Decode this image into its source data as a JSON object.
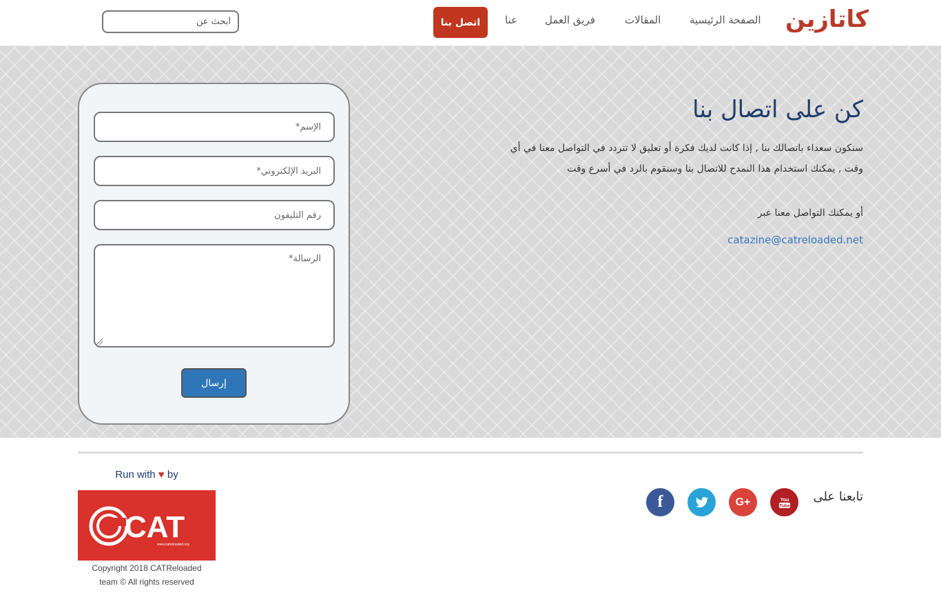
{
  "nav": {
    "brand": "كاتازين",
    "home": "الصفحة الرئيسية",
    "articles": "المقالات",
    "team": "فريق العمل",
    "about": "عنا",
    "contact": "اتصل بنا",
    "search_placeholder": "أبحث عن"
  },
  "form": {
    "name_placeholder": "الإسم*",
    "email_placeholder": "البريد الإلكتروني*",
    "phone_placeholder": "رقم التليفون",
    "message_placeholder": "الرسالة*",
    "send_label": "إرسال"
  },
  "contact": {
    "title": "كن على اتصال بنا",
    "description": "سنكون سعداء باتصالك بنا , إذا كانت لديك فكرة أو تعليق لا تتردد في التواصل معنا في أي وقت , يمكنك استخدام هذا النمدج للاتصال بنا وسنقوم بالرد في أسرع وقت",
    "alt_text": "أو يمكنك التواصل معنا عبر",
    "email": "catazine@catreloaded.net"
  },
  "footer": {
    "follow_label": "تابعنا على",
    "run_with_prefix": "Run with",
    "run_with_suffix": "by",
    "logo_text": "@CAT",
    "logo_url": "www.catreloaded.org",
    "copyright_line1": "Copyright 2018 CATReloaded",
    "copyright_line2": "team © All rights reserved",
    "social": [
      "youtube-icon",
      "google-plus-icon",
      "twitter-icon",
      "facebook-icon"
    ]
  },
  "colors": {
    "brand": "#b83a28",
    "contact_button": "#c1361f",
    "send_button": "#2e76b8",
    "title": "#1f3d6c",
    "link": "#3a78c0",
    "cat_logo_bg": "#d9312b"
  }
}
